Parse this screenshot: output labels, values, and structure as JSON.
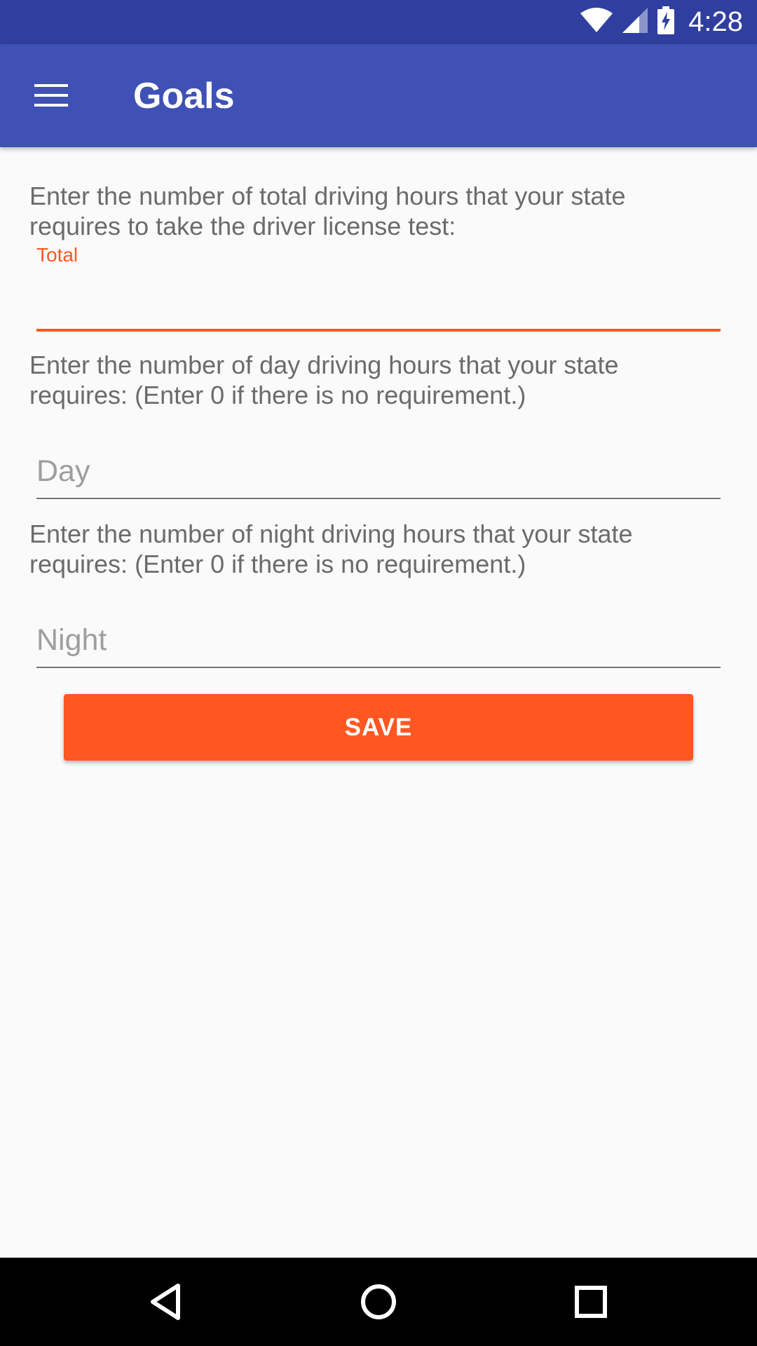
{
  "status_bar": {
    "time": "4:28",
    "icons": [
      "wifi-icon",
      "signal-icon",
      "battery-charging-icon"
    ]
  },
  "app_bar": {
    "title": "Goals",
    "menu_icon": "hamburger-menu-icon"
  },
  "form": {
    "total": {
      "description": "Enter the number of total driving hours that your state requires to take the driver license test:",
      "label": "Total",
      "value": ""
    },
    "day": {
      "description": "Enter the number of day driving hours that your state requires: (Enter 0 if there is no requirement.)",
      "placeholder": "Day",
      "value": ""
    },
    "night": {
      "description": "Enter the number of night driving hours that your state requires: (Enter 0 if there is no requirement.)",
      "placeholder": "Night",
      "value": ""
    },
    "save_label": "SAVE"
  },
  "nav_bar": {
    "icons": [
      "back-icon",
      "home-icon",
      "recents-icon"
    ]
  },
  "colors": {
    "status_bar": "#303f9f",
    "app_bar": "#3f51b5",
    "accent": "#ff5722",
    "background": "#fafafa"
  }
}
